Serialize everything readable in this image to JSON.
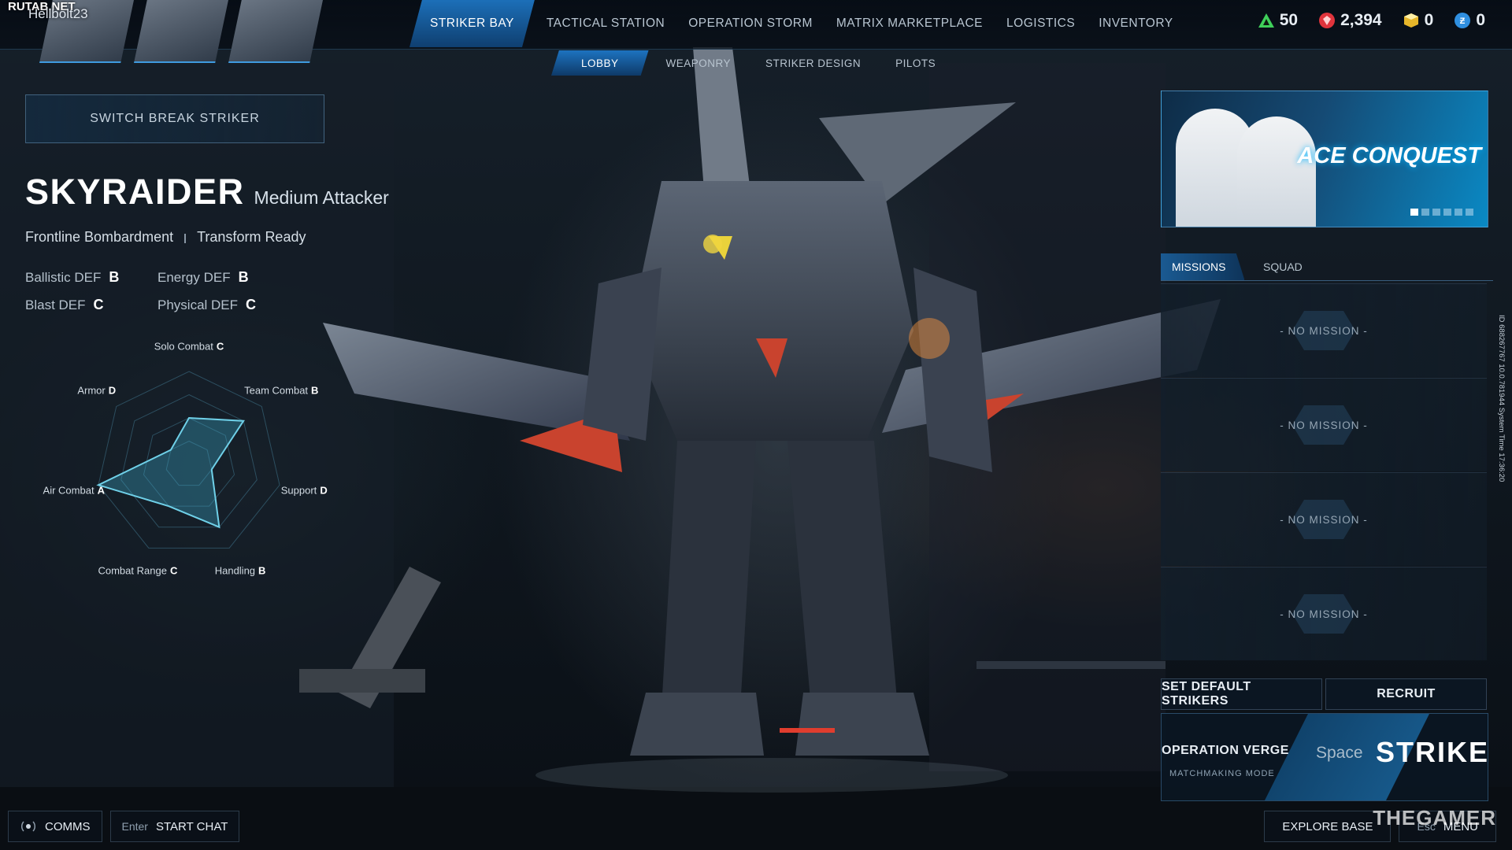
{
  "watermarks": {
    "top_left": "RUTAB.NET",
    "bottom_right": "THEGAMER"
  },
  "player": {
    "name": "Hellbolt23"
  },
  "nav": {
    "tabs": [
      {
        "label": "STRIKER BAY",
        "active": true
      },
      {
        "label": "TACTICAL STATION",
        "active": false
      },
      {
        "label": "OPERATION STORM",
        "active": false
      },
      {
        "label": "MATRIX MARKETPLACE",
        "active": false
      },
      {
        "label": "LOGISTICS",
        "active": false
      },
      {
        "label": "INVENTORY",
        "active": false
      }
    ],
    "sub_tabs": [
      {
        "label": "LOBBY",
        "active": true
      },
      {
        "label": "WEAPONRY",
        "active": false
      },
      {
        "label": "STRIKER DESIGN",
        "active": false
      },
      {
        "label": "PILOTS",
        "active": false
      }
    ]
  },
  "currencies": [
    {
      "icon": "green-triangle-icon",
      "value": "50",
      "color": "#3fcf5a"
    },
    {
      "icon": "red-gem-icon",
      "value": "2,394",
      "color": "#e0343c"
    },
    {
      "icon": "gold-cube-icon",
      "value": "0",
      "color": "#e6b62a"
    },
    {
      "icon": "blue-coin-icon",
      "value": "0",
      "color": "#2f8fe0"
    }
  ],
  "striker": {
    "switch_label": "SWITCH BREAK STRIKER",
    "name": "SKYRAIDER",
    "class": "Medium Attacker",
    "traits": [
      "Frontline Bombardment",
      "Transform Ready"
    ],
    "defenses": [
      {
        "label": "Ballistic DEF",
        "grade": "B"
      },
      {
        "label": "Energy DEF",
        "grade": "B"
      },
      {
        "label": "Blast DEF",
        "grade": "C"
      },
      {
        "label": "Physical DEF",
        "grade": "C"
      }
    ]
  },
  "chart_data": {
    "type": "radar",
    "grade_scale": [
      "D",
      "C",
      "B",
      "A"
    ],
    "axes": [
      {
        "label": "Solo Combat",
        "grade": "C"
      },
      {
        "label": "Team Combat",
        "grade": "B"
      },
      {
        "label": "Support",
        "grade": "D"
      },
      {
        "label": "Handling",
        "grade": "B"
      },
      {
        "label": "Combat Range",
        "grade": "C"
      },
      {
        "label": "Air Combat",
        "grade": "A"
      },
      {
        "label": "Armor",
        "grade": "D"
      }
    ]
  },
  "promo": {
    "title": "ACE CONQUEST",
    "slides": 6,
    "active_slide": 1
  },
  "panel": {
    "tabs": [
      {
        "label": "MISSIONS",
        "active": true
      },
      {
        "label": "SQUAD",
        "active": false
      }
    ],
    "missions": [
      "- NO MISSION -",
      "- NO MISSION -",
      "- NO MISSION -",
      "- NO MISSION -"
    ]
  },
  "actions": {
    "set_default": "SET DEFAULT STRIKERS",
    "recruit": "RECRUIT",
    "mode": "OPERATION VERGE",
    "mode_sub": "MATCHMAKING MODE",
    "strike_key": "Space",
    "strike": "STRIKE"
  },
  "bottom": {
    "comms": "COMMS",
    "chat_key": "Enter",
    "chat": "START CHAT",
    "explore": "EXPLORE BASE",
    "menu_key": "Esc",
    "menu": "MENU"
  },
  "side_info": {
    "text": "ID 688267767   10.0.781944   System Time   17:36:20"
  }
}
